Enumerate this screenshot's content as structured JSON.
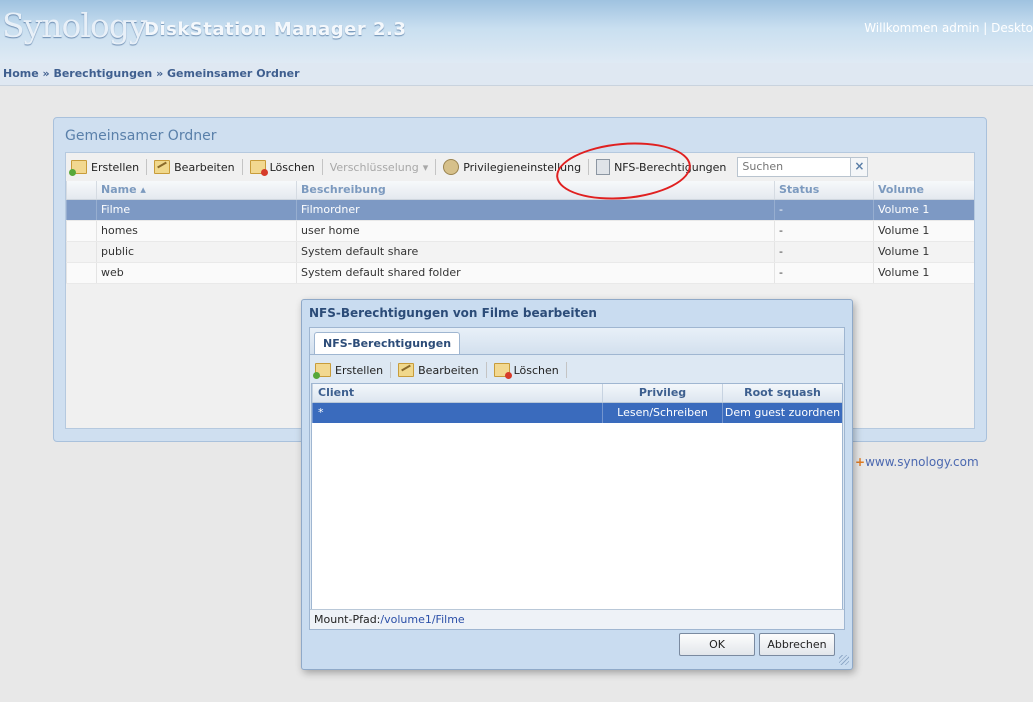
{
  "header": {
    "logo": "Synology",
    "product": "DiskStation Manager 2.3",
    "welcome": "Willkommen admin | Deskto"
  },
  "breadcrumb": "Home » Berechtigungen » Gemeinsamer Ordner",
  "panel": {
    "title": "Gemeinsamer Ordner",
    "toolbar": {
      "create": "Erstellen",
      "edit": "Bearbeiten",
      "delete": "Löschen",
      "encryption": "Verschlüsselung",
      "privileges": "Privilegieneinstellung",
      "nfs": "NFS-Berechtigungen",
      "search_placeholder": "Suchen"
    },
    "columns": [
      "Name",
      "Beschreibung",
      "Status",
      "Volume"
    ],
    "rows": [
      {
        "name": "Filme",
        "description": "Filmordner",
        "status": "-",
        "volume": "Volume 1",
        "selected": true
      },
      {
        "name": "homes",
        "description": "user home",
        "status": "-",
        "volume": "Volume 1",
        "selected": false
      },
      {
        "name": "public",
        "description": "System default share",
        "status": "-",
        "volume": "Volume 1",
        "selected": false
      },
      {
        "name": "web",
        "description": "System default shared folder",
        "status": "-",
        "volume": "Volume 1",
        "selected": false
      }
    ]
  },
  "link": "www.synology.com",
  "dialog": {
    "title": "NFS-Berechtigungen von Filme bearbeiten",
    "tab": "NFS-Berechtigungen",
    "toolbar": {
      "create": "Erstellen",
      "edit": "Bearbeiten",
      "delete": "Löschen"
    },
    "columns": [
      "Client",
      "Privileg",
      "Root squash"
    ],
    "rows": [
      {
        "client": "*",
        "privilege": "Lesen/Schreiben",
        "root_squash": "Dem guest zuordnen"
      }
    ],
    "mount_label": "Mount-Pfad:",
    "mount_path": "/volume1/Filme",
    "ok": "OK",
    "cancel": "Abbrechen"
  }
}
